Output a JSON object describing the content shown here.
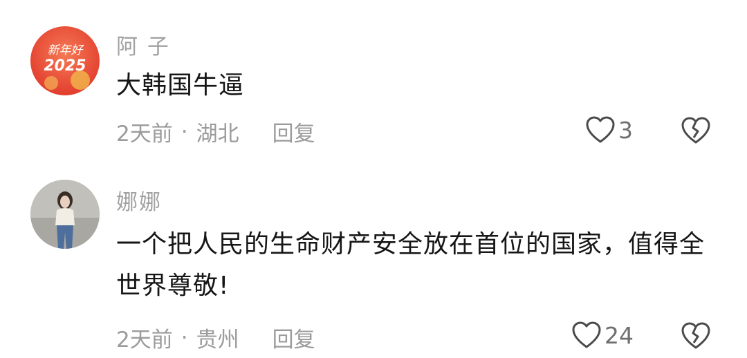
{
  "comments": [
    {
      "username": "阿 子",
      "avatar_icon": "red-new-year-2025-avatar",
      "avatar_text": "新年好 2025",
      "text": "大韩国牛逼",
      "time": "2天前",
      "location": "湖北",
      "reply_label": "回复",
      "like_count": "3"
    },
    {
      "username": "娜娜",
      "avatar_icon": "woman-photo-avatar",
      "text": "一个把人民的生命财产安全放在首位的国家，值得全世界尊敬!",
      "time": "2天前",
      "location": "贵州",
      "reply_label": "回复",
      "like_count": "24"
    }
  ],
  "separator": "·",
  "colors": {
    "avatar_red": "#e8452f",
    "text": "#161616",
    "muted": "#9b9b9b"
  }
}
